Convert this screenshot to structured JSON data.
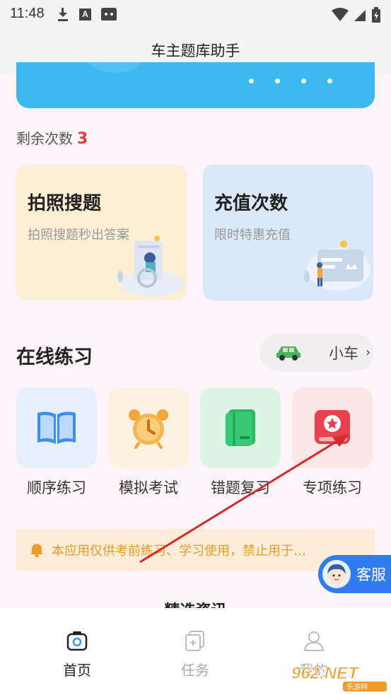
{
  "status_bar": {
    "time": "11:48"
  },
  "header": {
    "title": "车主题库助手"
  },
  "remaining": {
    "label": "剩余次数",
    "count": "3"
  },
  "cards": {
    "photo": {
      "title": "拍照搜题",
      "subtitle": "拍照搜题秒出答案"
    },
    "recharge": {
      "title": "充值次数",
      "subtitle": "限时特惠充值"
    }
  },
  "online_practice": {
    "title": "在线练习",
    "vehicle": "小车",
    "items": [
      {
        "label": "顺序练习"
      },
      {
        "label": "模拟考试"
      },
      {
        "label": "错题复习"
      },
      {
        "label": "专项练习"
      }
    ]
  },
  "notice": {
    "text": "本应用仅供考前练习、学习使用，禁止用于…"
  },
  "customer_service": {
    "label": "客服"
  },
  "featured": {
    "title": "精选资讯"
  },
  "tabbar": {
    "home": "首页",
    "tasks": "任务",
    "mine": "我的"
  },
  "watermark": {
    "text": "962.NET",
    "subtext": "乐游网"
  },
  "colors": {
    "accent_red": "#e83b3b",
    "banner_blue": "#3db8f1",
    "notice_orange": "#ef9b2a",
    "cs_blue": "#2f7cf0"
  }
}
